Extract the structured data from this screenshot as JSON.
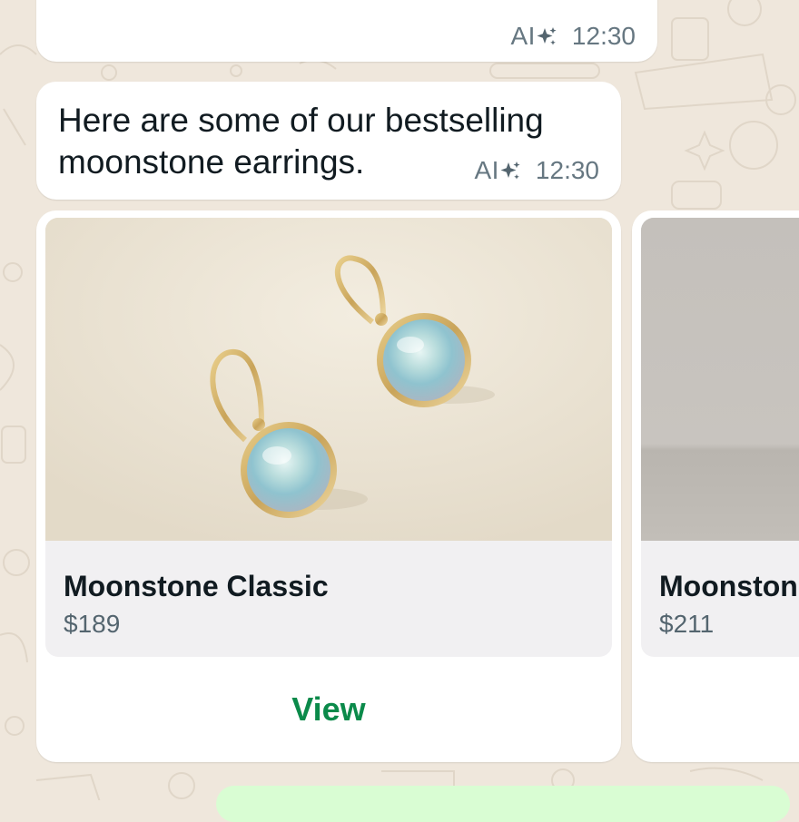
{
  "colors": {
    "chat_background": "#efe7dc",
    "bubble": "#ffffff",
    "outgoing_bubble": "#d9fdd3",
    "accent_green": "#0b8a4a",
    "meta_text": "#667781"
  },
  "previous_message": {
    "ai_label": "AI",
    "sparkle_icon": "ai-sparkle-icon",
    "time": "12:30"
  },
  "message": {
    "text": "Here are some of our bestselling moonstone earrings.",
    "ai_label": "AI",
    "sparkle_icon": "ai-sparkle-icon",
    "time": "12:30"
  },
  "carousel": {
    "cards": [
      {
        "name": "Moonstone Classic",
        "price": "$189",
        "button": "View"
      },
      {
        "name": "Moonston",
        "price": "$211"
      }
    ]
  }
}
